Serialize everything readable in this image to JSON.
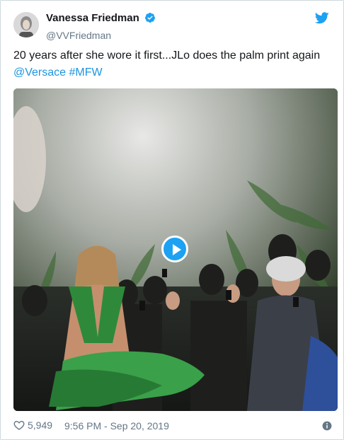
{
  "author": {
    "display_name": "Vanessa Friedman",
    "handle": "@VVFriedman"
  },
  "tweet": {
    "text_main": "20 years after she wore it first...JLo does the palm print again",
    "mention": "@Versace",
    "hashtag": "#MFW"
  },
  "footer": {
    "likes": "5,949",
    "timestamp": "9:56 PM - Sep 20, 2019"
  },
  "icons": {
    "verified": "verified-badge-icon",
    "bird": "twitter-bird-icon",
    "like": "heart-icon",
    "info": "info-icon",
    "play": "play-icon"
  },
  "colors": {
    "accent": "#1da1f2",
    "link": "#1b95e0",
    "muted": "#657786"
  }
}
